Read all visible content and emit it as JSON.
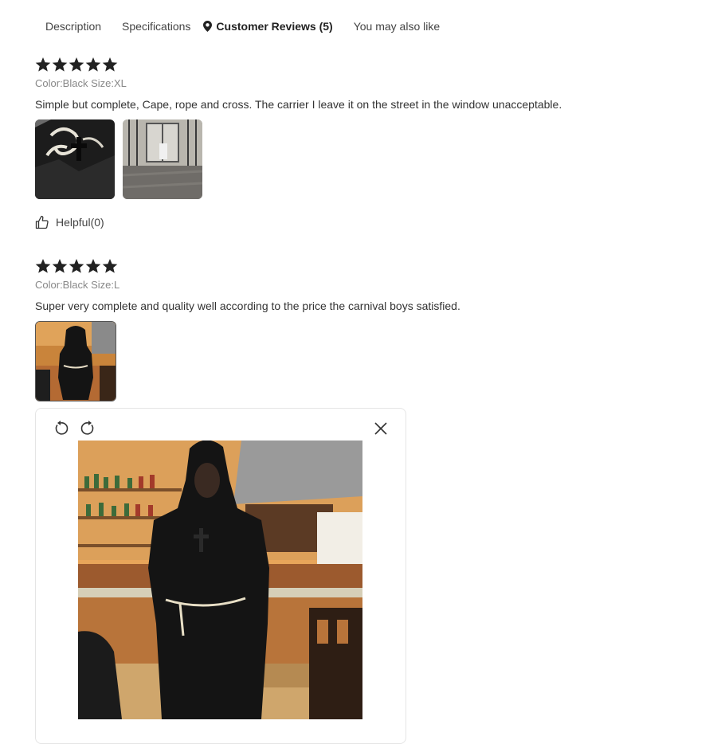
{
  "tabs": [
    {
      "label": "Description"
    },
    {
      "label": "Specifications"
    },
    {
      "label": "Customer Reviews (5)"
    },
    {
      "label": "You may also like"
    }
  ],
  "reviews": [
    {
      "rating": 5,
      "meta": "Color:Black Size:XL",
      "text": "Simple but complete, Cape, rope and cross. The carrier I leave it on the street in the window unacceptable.",
      "helpful": "Helpful(0)"
    },
    {
      "rating": 5,
      "meta": "Color:Black Size:L",
      "text": "Super very complete and quality well according to the price the carnival boys satisfied."
    }
  ],
  "icons": {
    "star": "star-icon",
    "location": "location-pin-icon",
    "thumbs_up": "thumbs-up-icon",
    "rotate_left": "rotate-left-icon",
    "rotate_right": "rotate-right-icon",
    "close": "close-icon"
  },
  "colors": {
    "star": "#222222",
    "text": "#333333",
    "meta": "#888888",
    "viewer_border": "#e5e5e5"
  }
}
